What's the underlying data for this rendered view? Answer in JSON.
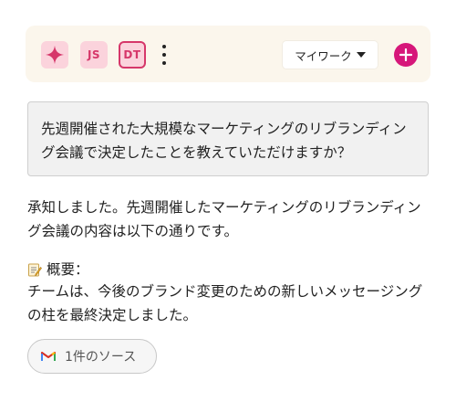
{
  "toolbar": {
    "avatars": [
      {
        "initials": "JS"
      },
      {
        "initials": "DT"
      }
    ],
    "workspace_label": "マイワーク",
    "icons": {
      "ai": "sparkle-icon",
      "menu": "kebab-icon",
      "dropdown": "caret-down-icon",
      "add": "plus-icon"
    }
  },
  "chat": {
    "user_question": "先週開催された大規模なマーケティングのリブランディング会議で決定したことを教えていただけますか？",
    "assistant_intro": "承知しました。先週開催したマーケティングのリブランディング会議の内容は以下の通りです。",
    "summary_heading": "概要：",
    "summary_body": "チームは、今後のブランド変更のための新しいメッセージングの柱を最終決定しました。",
    "sources_label": "1件のソース",
    "icons": {
      "memo": "memo-icon",
      "source": "gmail-icon"
    }
  },
  "colors": {
    "accent": "#d6177a",
    "avatar_bg": "#fbd3dc",
    "avatar_text": "#d6376a",
    "toolbar_bg": "#fbf6ec",
    "question_bg": "#f1f1f1"
  }
}
